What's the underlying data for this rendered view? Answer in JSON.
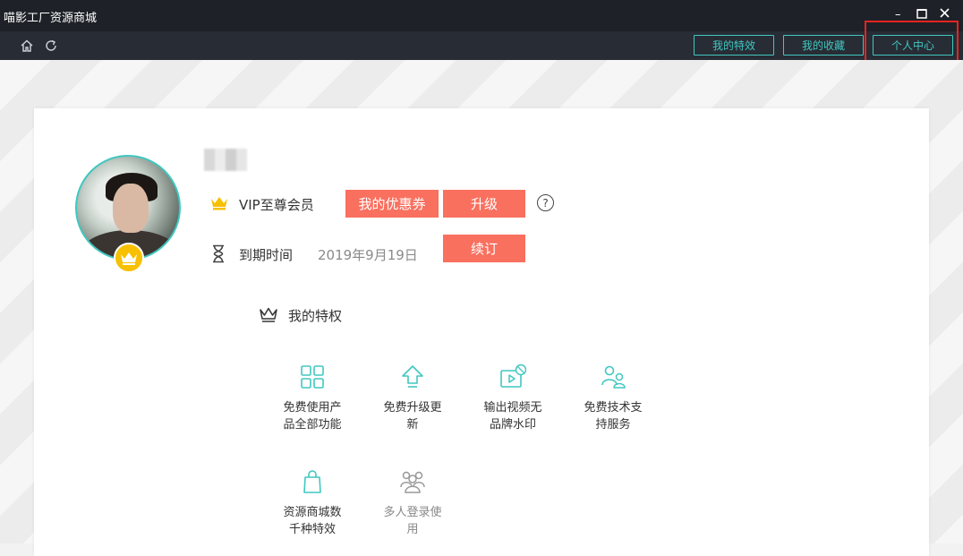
{
  "window": {
    "title": "喵影工厂资源商城",
    "minimize": "–",
    "maximize": "☐",
    "close": "✕"
  },
  "toolbar": {
    "buttons": [
      "我的特效",
      "我的收藏",
      "个人中心"
    ]
  },
  "profile": {
    "vip_label": "VIP至尊会员",
    "coupon_button": "我的优惠券",
    "upgrade_button": "升级",
    "help": "?",
    "expire_label": "到期时间",
    "expire_date": "2019年9月19日",
    "renew_button": "续订"
  },
  "privileges": {
    "title": "我的特权",
    "items": [
      {
        "line1": "免费使用产",
        "line2": "品全部功能",
        "icon": "grid-icon"
      },
      {
        "line1": "免费升级更",
        "line2": "新",
        "icon": "upgrade-arrow-icon"
      },
      {
        "line1": "输出视频无",
        "line2": "品牌水印",
        "icon": "video-no-watermark-icon"
      },
      {
        "line1": "免费技术支",
        "line2": "持服务",
        "icon": "support-users-icon"
      },
      {
        "line1": "资源商城数",
        "line2": "千种特效",
        "icon": "shopping-bag-icon"
      },
      {
        "line1": "多人登录使",
        "line2": "用",
        "icon": "multi-user-icon"
      }
    ]
  },
  "colors": {
    "accent": "#41c7c0",
    "button_red": "#f9705f",
    "crown_gold": "#f7c000",
    "highlight": "#e52420"
  }
}
